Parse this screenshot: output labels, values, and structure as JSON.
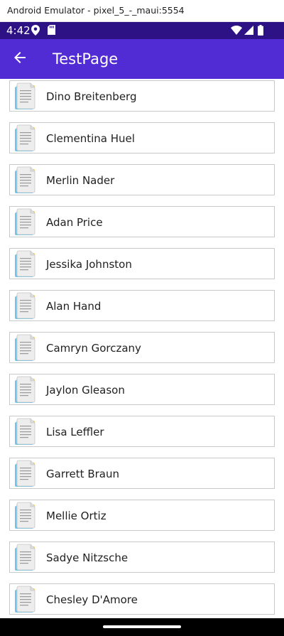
{
  "window": {
    "title": "Android Emulator - pixel_5_-_maui:5554"
  },
  "status_bar": {
    "time": "4:42",
    "icons": [
      "location-icon",
      "sd-card-icon",
      "wifi-icon",
      "signal-icon",
      "battery-icon"
    ]
  },
  "app_bar": {
    "title": "TestPage",
    "back_icon": "back-arrow-icon",
    "color": "#512bd4"
  },
  "list": {
    "item_icon": "document-icon",
    "items": [
      "Dino Breitenberg",
      "Clementina Huel",
      "Merlin Nader",
      "Adan Price",
      "Jessika Johnston",
      "Alan Hand",
      "Camryn Gorczany",
      "Jaylon Gleason",
      "Lisa Leffler",
      "Garrett Braun",
      "Mellie Ortiz",
      "Sadye Nitzsche",
      "Chesley D'Amore"
    ]
  },
  "colors": {
    "status_bar": "#2d1286",
    "app_bar": "#512bd4",
    "nav_bar": "#000000"
  }
}
